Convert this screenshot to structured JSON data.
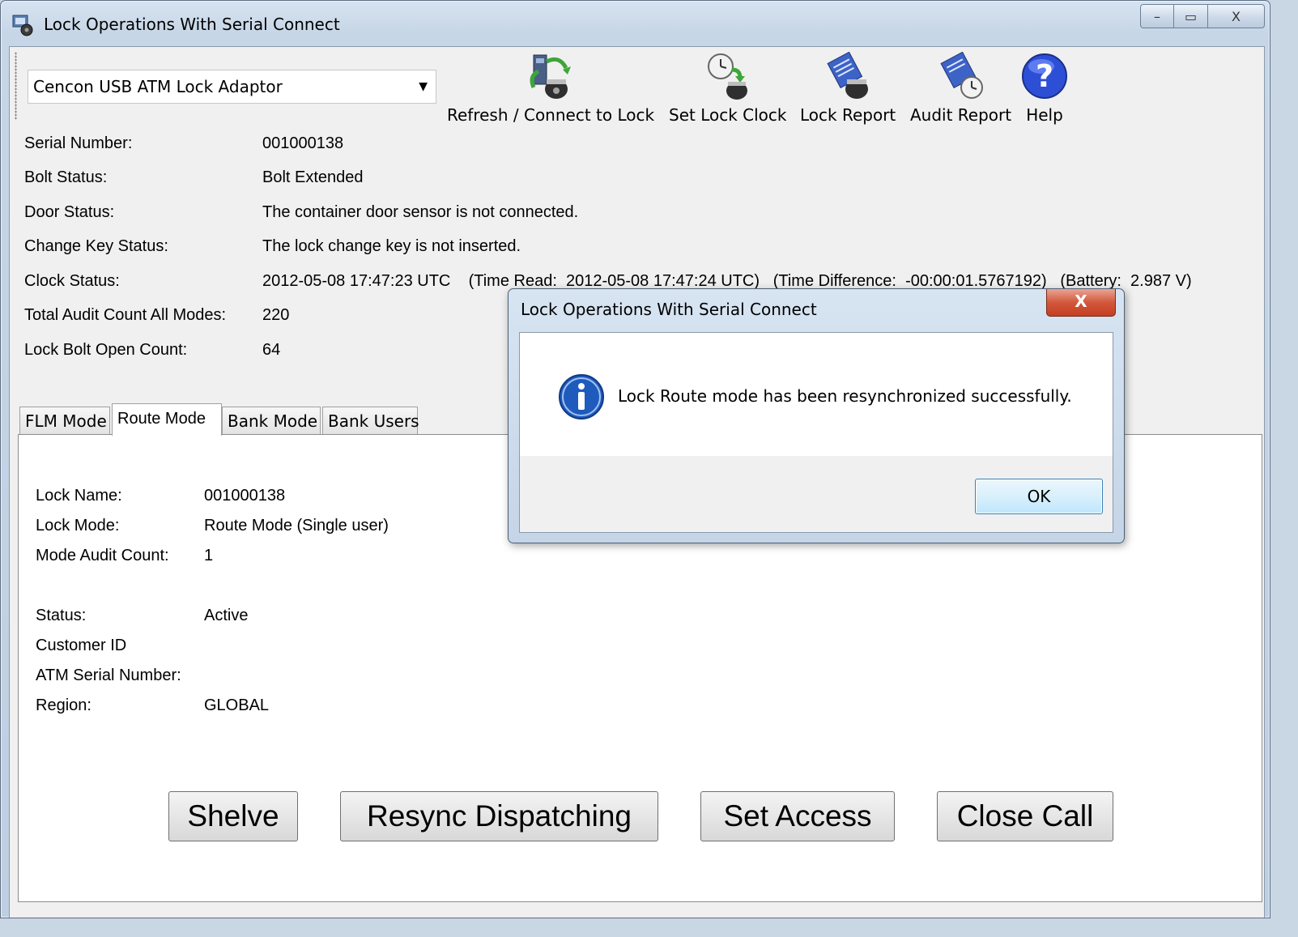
{
  "window": {
    "title": "Lock Operations With Serial Connect",
    "minimize_glyph": "–",
    "maximize_glyph": "▭",
    "close_glyph": "X"
  },
  "toolbar": {
    "device_select": {
      "selected": "Cencon USB ATM Lock Adaptor",
      "arrow": "▼"
    },
    "tools": [
      {
        "label": "Refresh / Connect to Lock",
        "icon": "refresh-connect-icon"
      },
      {
        "label": "Set Lock Clock",
        "icon": "set-clock-icon"
      },
      {
        "label": "Lock Report",
        "icon": "lock-report-icon"
      },
      {
        "label": "Audit Report",
        "icon": "audit-report-icon"
      },
      {
        "label": "Help",
        "icon": "help-icon"
      }
    ]
  },
  "info": [
    {
      "label": "Serial Number:",
      "value": "001000138"
    },
    {
      "label": "Bolt Status:",
      "value": "Bolt Extended"
    },
    {
      "label": "Door Status:",
      "value": "The container door sensor is not connected."
    },
    {
      "label": "Change Key Status:",
      "value": "The lock change key is not inserted."
    },
    {
      "label": "Clock Status:",
      "value": "2012-05-08 17:47:23 UTC    (Time Read:  2012-05-08 17:47:24 UTC)   (Time Difference:  -00:00:01.5767192)   (Battery:  2.987 V)"
    },
    {
      "label": "Total Audit Count All Modes:",
      "value": "220"
    },
    {
      "label": "Lock Bolt Open Count:",
      "value": "64"
    }
  ],
  "tabs": [
    {
      "label": "FLM Mode",
      "active": false
    },
    {
      "label": "Route Mode",
      "active": true
    },
    {
      "label": "Bank Mode",
      "active": false
    },
    {
      "label": "Bank Users",
      "active": false
    }
  ],
  "route_mode": {
    "fields": [
      {
        "label": "Lock Name:",
        "value": "001000138"
      },
      {
        "label": "Lock Mode:",
        "value": "Route Mode (Single user)"
      },
      {
        "label": "Mode Audit Count:",
        "value": "1"
      },
      {
        "label": "Status:",
        "value": "Active"
      },
      {
        "label": "Customer ID",
        "value": ""
      },
      {
        "label": "ATM Serial Number:",
        "value": ""
      },
      {
        "label": "Region:",
        "value": "GLOBAL"
      }
    ],
    "buttons": {
      "shelve": "Shelve",
      "resync": "Resync Dispatching",
      "set_access": "Set Access",
      "close_call": "Close Call"
    }
  },
  "dialog": {
    "title": "Lock Operations With Serial Connect",
    "close_glyph": "X",
    "message": "Lock Route mode has been resynchronized successfully.",
    "icon": "info-icon",
    "ok_label": "OK"
  },
  "colors": {
    "info_icon": "#1f5bbd",
    "help_icon": "#2d4fd6",
    "dialog_close": "#c43e22",
    "ok_border": "#3c7fb1"
  }
}
